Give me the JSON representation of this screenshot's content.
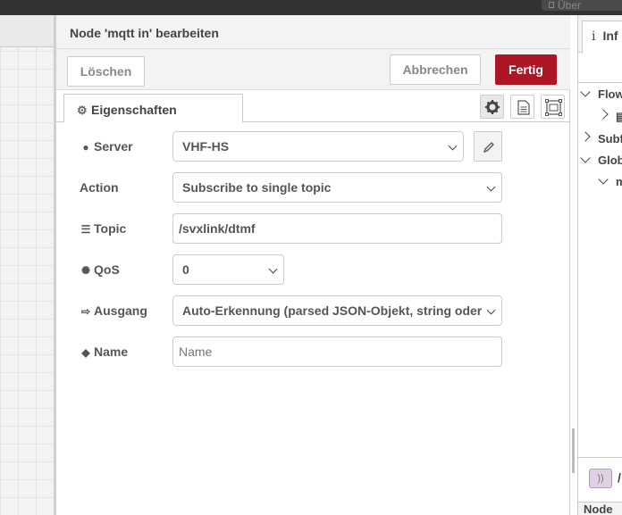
{
  "header": {
    "button_label": "Über"
  },
  "editor": {
    "title": "Node 'mqtt in' bearbeiten",
    "delete_label": "Löschen",
    "cancel_label": "Abbrechen",
    "done_label": "Fertig",
    "done_color": "#ad1625"
  },
  "tabs": {
    "properties_label": "Eigenschaften"
  },
  "form": {
    "server": {
      "label": "Server",
      "value": "VHF-HS",
      "icon": "globe-icon"
    },
    "action": {
      "label": "Action",
      "value": "Subscribe to single topic"
    },
    "topic": {
      "label": "Topic",
      "value": "/svxlink/dtmf",
      "icon": "tasks-icon"
    },
    "qos": {
      "label": "QoS",
      "value": "0",
      "icon": "empire-icon"
    },
    "output": {
      "label": "Ausgang",
      "value": "Auto-Erkennung (parsed JSON-Objekt, string oder",
      "icon": "sign-out-icon"
    },
    "name": {
      "label": "Name",
      "value": "",
      "placeholder": "Name",
      "icon": "tag-icon"
    }
  },
  "sidebar": {
    "tab_label": "Inf",
    "items": [
      "Flow",
      "Subf",
      "Glob",
      "m"
    ],
    "chip_label": "))",
    "chip_suffix": "/",
    "footer_label": "Node"
  }
}
